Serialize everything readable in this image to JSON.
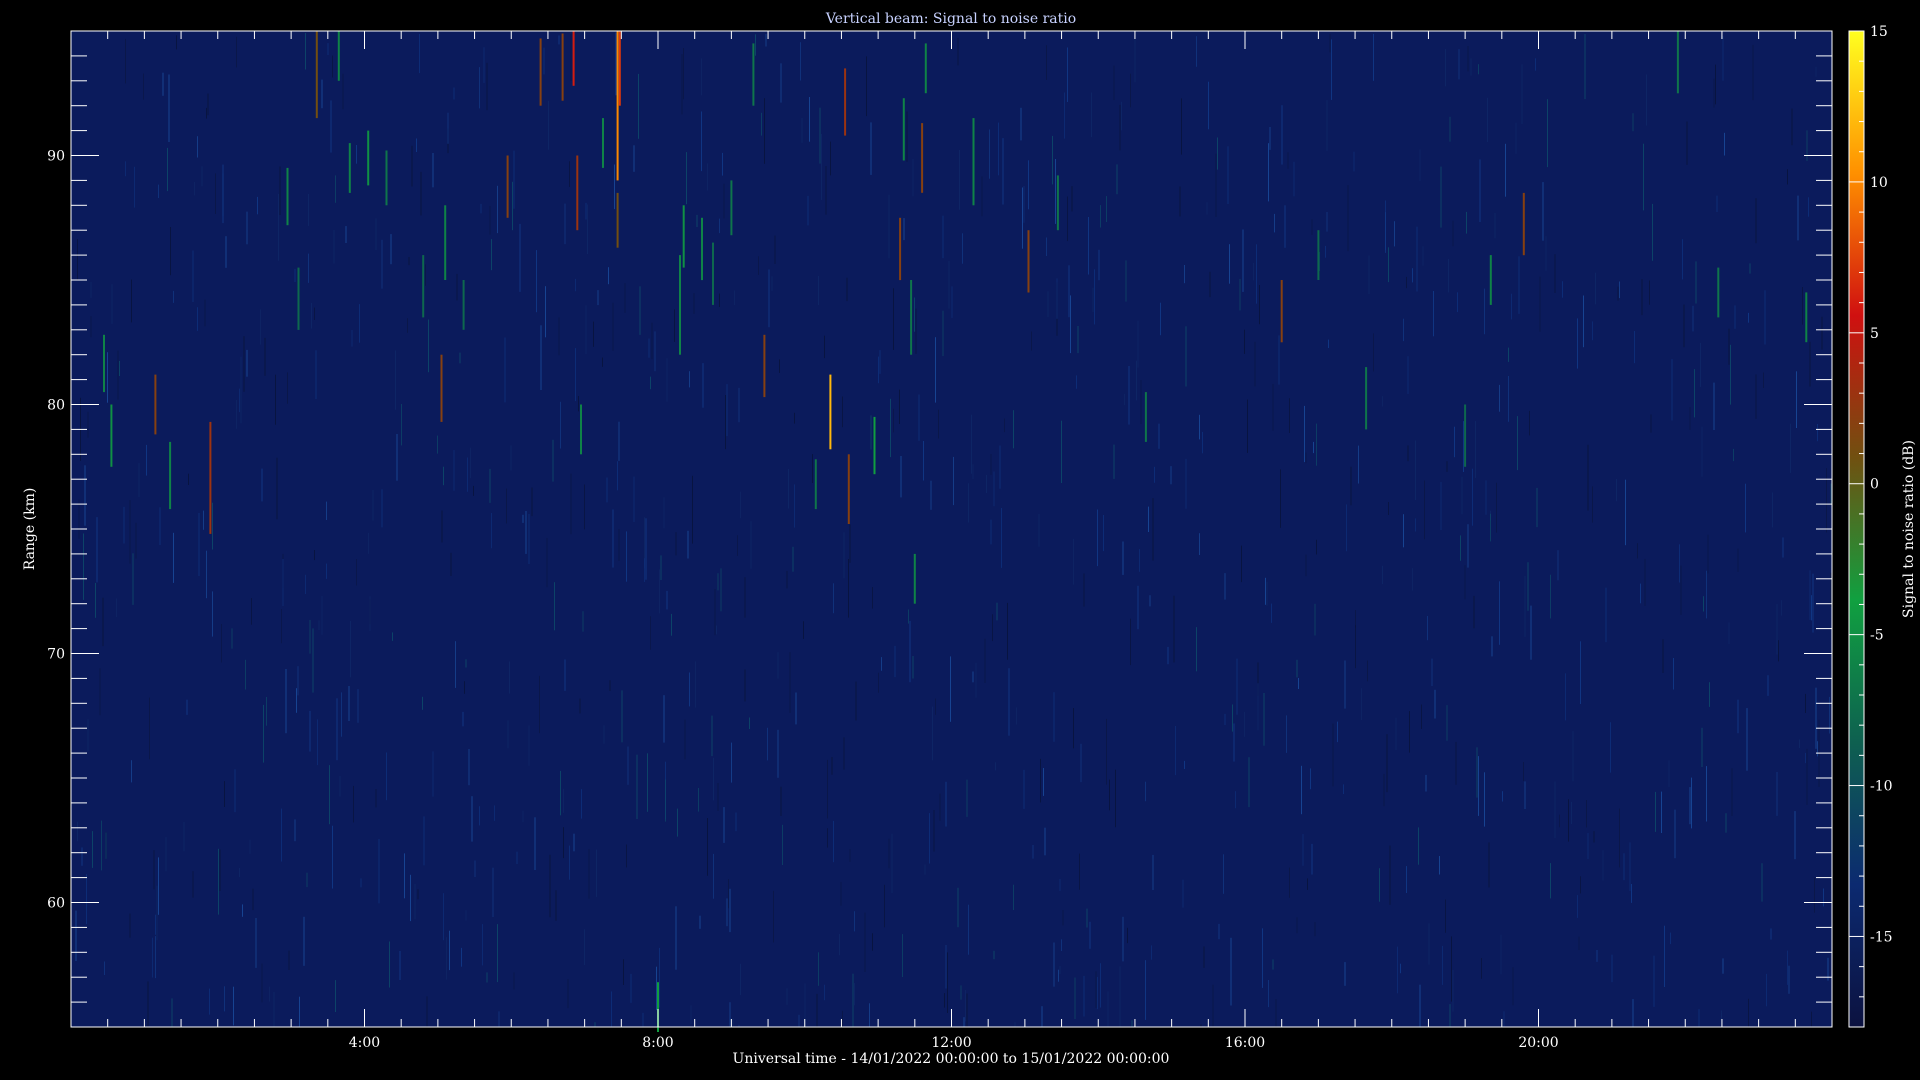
{
  "chart_data": {
    "type": "heatmap",
    "title": "Vertical beam: Signal to noise ratio",
    "xlabel": "Universal time - 14/01/2022 00:00:00 to 15/01/2022 00:00:00",
    "ylabel": "Range (km)",
    "colorbar_label": "Signal to noise ratio (dB)",
    "xlim": [
      0,
      24
    ],
    "ylim": [
      55,
      95
    ],
    "x_ticks": [
      {
        "value": 4,
        "label": "4:00"
      },
      {
        "value": 8,
        "label": "8:00"
      },
      {
        "value": 12,
        "label": "12:00"
      },
      {
        "value": 16,
        "label": "16:00"
      },
      {
        "value": 20,
        "label": "20:00"
      }
    ],
    "y_ticks": [
      {
        "value": 60,
        "label": "60"
      },
      {
        "value": 70,
        "label": "70"
      },
      {
        "value": 80,
        "label": "80"
      },
      {
        "value": 90,
        "label": "90"
      }
    ],
    "colorbar_range": [
      -18,
      15
    ],
    "colorbar_ticks": [
      {
        "value": -15,
        "label": "-15"
      },
      {
        "value": -10,
        "label": "-10"
      },
      {
        "value": -5,
        "label": "-5"
      },
      {
        "value": 0,
        "label": "0"
      },
      {
        "value": 5,
        "label": "5"
      },
      {
        "value": 10,
        "label": "10"
      },
      {
        "value": 15,
        "label": "15"
      }
    ],
    "colormap": [
      "#0c1240",
      "#0c2a70",
      "#0e6050",
      "#10a040",
      "#705010",
      "#d01010",
      "#ff9000",
      "#ffff20"
    ],
    "background_value": -16,
    "streaks": [
      {
        "t": 0.45,
        "r0": 80.5,
        "r1": 82.8,
        "snr": -6
      },
      {
        "t": 0.55,
        "r0": 77.5,
        "r1": 80.0,
        "snr": -5
      },
      {
        "t": 1.15,
        "r0": 78.8,
        "r1": 81.2,
        "snr": 2
      },
      {
        "t": 1.35,
        "r0": 75.8,
        "r1": 78.5,
        "snr": -6
      },
      {
        "t": 1.9,
        "r0": 74.8,
        "r1": 79.3,
        "snr": 3
      },
      {
        "t": 2.95,
        "r0": 87.2,
        "r1": 89.5,
        "snr": -6
      },
      {
        "t": 3.1,
        "r0": 83.0,
        "r1": 85.5,
        "snr": -8
      },
      {
        "t": 3.35,
        "r0": 91.5,
        "r1": 95.0,
        "snr": 1
      },
      {
        "t": 3.65,
        "r0": 93.0,
        "r1": 95.0,
        "snr": -6
      },
      {
        "t": 3.8,
        "r0": 88.5,
        "r1": 90.5,
        "snr": -6
      },
      {
        "t": 4.05,
        "r0": 88.8,
        "r1": 91.0,
        "snr": -5
      },
      {
        "t": 4.3,
        "r0": 88.0,
        "r1": 90.2,
        "snr": -7
      },
      {
        "t": 4.8,
        "r0": 83.5,
        "r1": 86.0,
        "snr": -8
      },
      {
        "t": 5.05,
        "r0": 79.3,
        "r1": 82.0,
        "snr": 2
      },
      {
        "t": 5.1,
        "r0": 85.0,
        "r1": 88.0,
        "snr": -6
      },
      {
        "t": 5.35,
        "r0": 83.0,
        "r1": 85.0,
        "snr": -8
      },
      {
        "t": 5.95,
        "r0": 87.5,
        "r1": 90.0,
        "snr": 2
      },
      {
        "t": 6.4,
        "r0": 92.0,
        "r1": 94.7,
        "snr": 2
      },
      {
        "t": 6.7,
        "r0": 92.2,
        "r1": 94.9,
        "snr": 2
      },
      {
        "t": 6.85,
        "r0": 92.8,
        "r1": 95.0,
        "snr": 6
      },
      {
        "t": 6.9,
        "r0": 87.0,
        "r1": 90.0,
        "snr": 3
      },
      {
        "t": 6.95,
        "r0": 78.0,
        "r1": 80.0,
        "snr": -6
      },
      {
        "t": 7.25,
        "r0": 89.5,
        "r1": 91.5,
        "snr": -6
      },
      {
        "t": 7.45,
        "r0": 86.3,
        "r1": 88.5,
        "snr": 1
      },
      {
        "t": 7.45,
        "r0": 89.0,
        "r1": 95.0,
        "snr": 10
      },
      {
        "t": 7.48,
        "r0": 92.0,
        "r1": 95.0,
        "snr": 7
      },
      {
        "t": 8.0,
        "r0": 54.8,
        "r1": 56.8,
        "snr": -4
      },
      {
        "t": 8.3,
        "r0": 82.0,
        "r1": 86.0,
        "snr": -6
      },
      {
        "t": 8.35,
        "r0": 85.5,
        "r1": 88.0,
        "snr": -5
      },
      {
        "t": 8.6,
        "r0": 85.0,
        "r1": 87.5,
        "snr": -6
      },
      {
        "t": 8.75,
        "r0": 84.0,
        "r1": 86.5,
        "snr": -8
      },
      {
        "t": 9.0,
        "r0": 86.8,
        "r1": 89.0,
        "snr": -7
      },
      {
        "t": 9.3,
        "r0": 92.0,
        "r1": 94.5,
        "snr": -7
      },
      {
        "t": 9.45,
        "r0": 80.3,
        "r1": 82.8,
        "snr": 2
      },
      {
        "t": 10.15,
        "r0": 75.8,
        "r1": 77.8,
        "snr": -7
      },
      {
        "t": 10.35,
        "r0": 78.2,
        "r1": 81.2,
        "snr": 12
      },
      {
        "t": 10.55,
        "r0": 90.8,
        "r1": 93.5,
        "snr": 3
      },
      {
        "t": 10.6,
        "r0": 75.2,
        "r1": 78.0,
        "snr": 2
      },
      {
        "t": 10.95,
        "r0": 77.2,
        "r1": 79.5,
        "snr": -4
      },
      {
        "t": 11.3,
        "r0": 85.0,
        "r1": 87.5,
        "snr": 2
      },
      {
        "t": 11.35,
        "r0": 89.8,
        "r1": 92.3,
        "snr": -6
      },
      {
        "t": 11.45,
        "r0": 82.0,
        "r1": 85.0,
        "snr": -7
      },
      {
        "t": 11.5,
        "r0": 72.0,
        "r1": 74.0,
        "snr": -6
      },
      {
        "t": 11.6,
        "r0": 88.5,
        "r1": 91.3,
        "snr": 2
      },
      {
        "t": 11.65,
        "r0": 92.5,
        "r1": 94.5,
        "snr": -6
      },
      {
        "t": 12.3,
        "r0": 88.0,
        "r1": 91.5,
        "snr": -6
      },
      {
        "t": 13.05,
        "r0": 84.5,
        "r1": 87.0,
        "snr": 2
      },
      {
        "t": 13.45,
        "r0": 87.0,
        "r1": 89.2,
        "snr": -7
      },
      {
        "t": 14.65,
        "r0": 78.5,
        "r1": 80.5,
        "snr": -7
      },
      {
        "t": 16.5,
        "r0": 82.5,
        "r1": 85.0,
        "snr": 2
      },
      {
        "t": 17.0,
        "r0": 85.0,
        "r1": 87.0,
        "snr": -8
      },
      {
        "t": 17.65,
        "r0": 79.0,
        "r1": 81.5,
        "snr": -7
      },
      {
        "t": 19.0,
        "r0": 77.5,
        "r1": 80.0,
        "snr": -8
      },
      {
        "t": 19.35,
        "r0": 84.0,
        "r1": 86.0,
        "snr": -6
      },
      {
        "t": 19.8,
        "r0": 86.0,
        "r1": 88.5,
        "snr": 2
      },
      {
        "t": 21.9,
        "r0": 92.5,
        "r1": 95.0,
        "snr": -7
      },
      {
        "t": 22.45,
        "r0": 83.5,
        "r1": 85.5,
        "snr": -7
      },
      {
        "t": 23.65,
        "r0": 82.5,
        "r1": 84.5,
        "snr": -6
      }
    ]
  }
}
